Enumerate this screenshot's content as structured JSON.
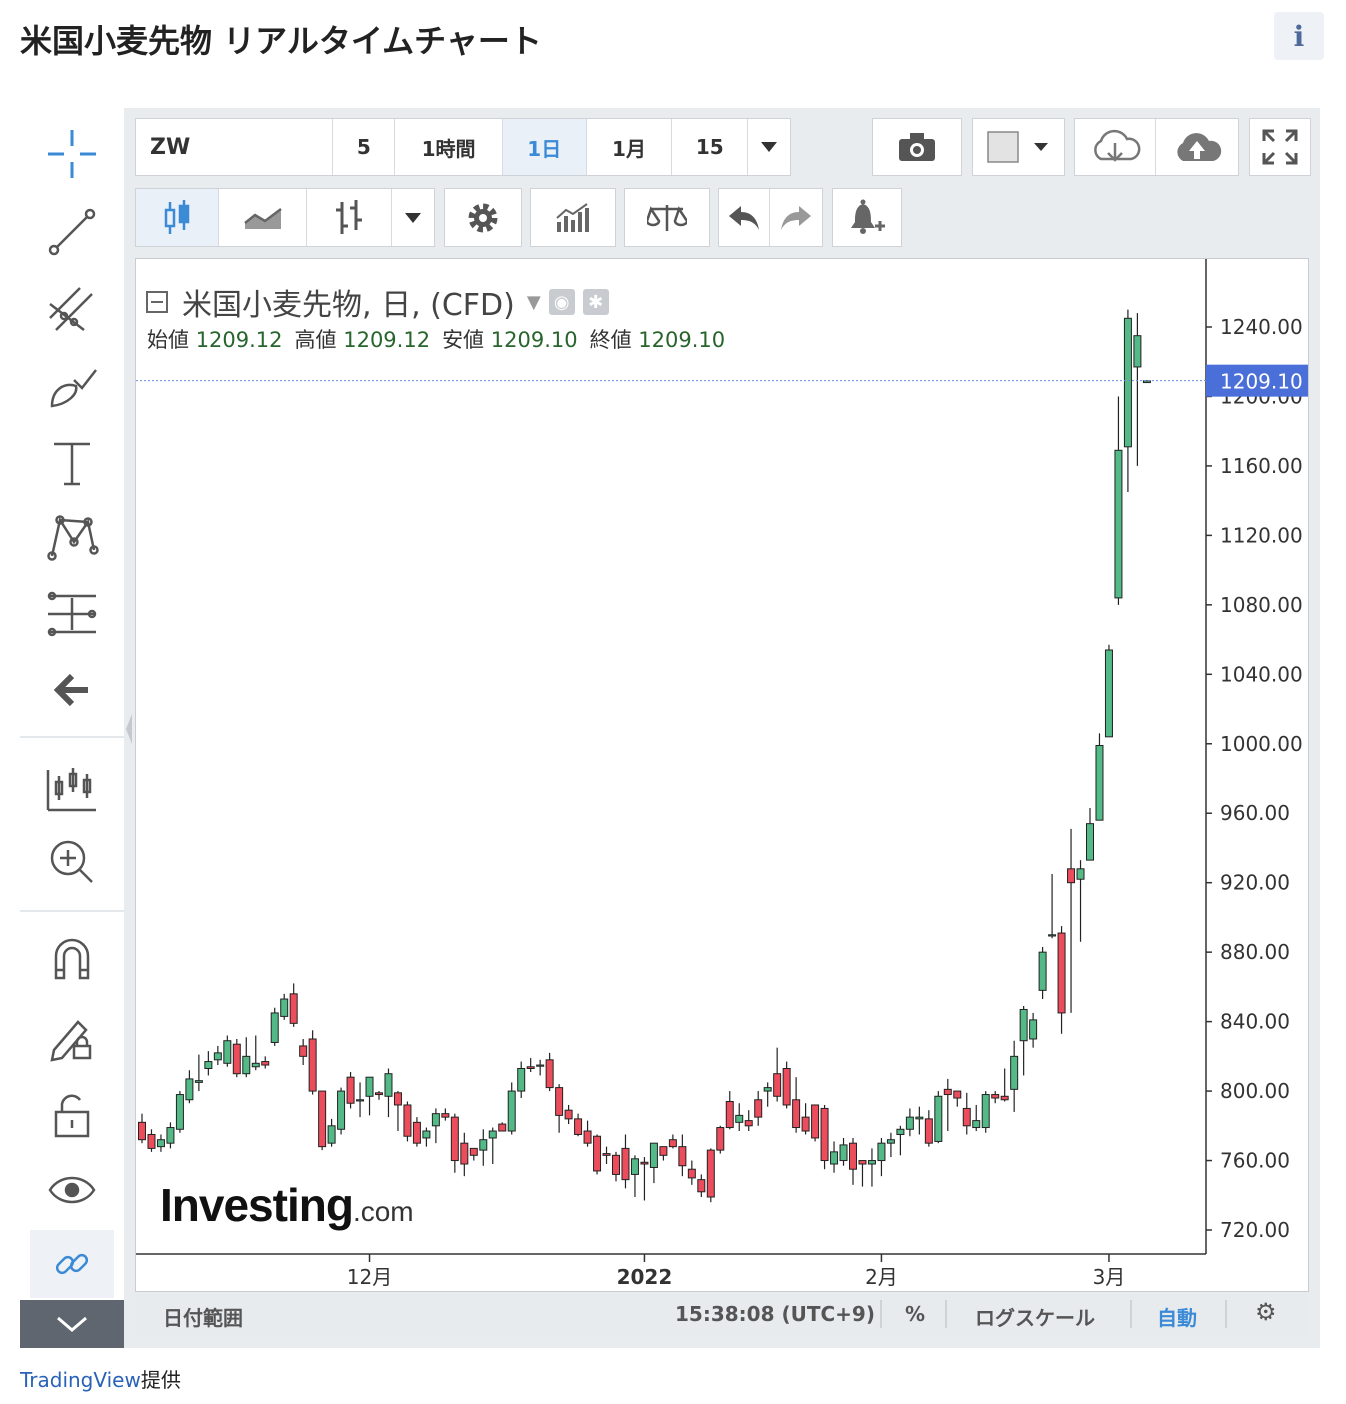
{
  "page": {
    "title": "米国小麦先物 リアルタイムチャート",
    "info_icon": "i"
  },
  "toolbar": {
    "symbol": "ZW",
    "intervals": [
      "5",
      "1時間",
      "1日",
      "1月",
      "15"
    ],
    "active_interval": "1日",
    "icons": [
      "camera-icon",
      "color-swatch-icon",
      "cloud-download-icon",
      "cloud-upload-icon",
      "fullscreen-icon"
    ]
  },
  "toolbar2": {
    "icons": [
      "candles-icon",
      "area-chart-icon",
      "bars-icon",
      "dropdown-icon",
      "settings-icon",
      "indicators-icon",
      "compare-icon",
      "undo-icon",
      "redo-icon",
      "alert-icon"
    ]
  },
  "sidebar": {
    "tools": [
      "crosshair-icon",
      "trendline-icon",
      "fib-icon",
      "brush-icon",
      "text-icon",
      "pattern-icon",
      "measure-icon",
      "back-arrow-icon",
      "candle-settings-icon",
      "zoom-icon",
      "magnet-icon",
      "lock-drawing-icon",
      "unlock-icon",
      "eye-icon",
      "link-icon"
    ]
  },
  "legend": {
    "title": "米国小麦先物, 日, (CFD)",
    "open_label": "始値",
    "open": "1209.12",
    "high_label": "高値",
    "high": "1209.12",
    "low_label": "安値",
    "low": "1209.10",
    "close_label": "終値",
    "close": "1209.10"
  },
  "price_axis": {
    "ticks": [
      "1240.00",
      "1200.00",
      "1160.00",
      "1120.00",
      "1080.00",
      "1040.00",
      "1000.00",
      "960.00",
      "920.00",
      "880.00",
      "840.00",
      "800.00",
      "760.00",
      "720.00"
    ],
    "current_price": "1209.10"
  },
  "time_axis": {
    "labels": [
      "12月",
      "2022",
      "2月",
      "3月"
    ]
  },
  "status_bar": {
    "date_range": "日付範囲",
    "time": "15:38:08 (UTC+9)",
    "percent": "%",
    "log_scale": "ログスケール",
    "auto": "自動"
  },
  "watermark": {
    "main": "Investing",
    "suffix": ".com"
  },
  "footer": {
    "brand": "TradingView",
    "suffix": "提供"
  },
  "colors": {
    "up": "#53b987",
    "down": "#eb4d5c",
    "accent": "#3a8ad6",
    "price_label": "#4a6fd8"
  },
  "chart_data": {
    "type": "candlestick",
    "title": "米国小麦先物, 日, (CFD)",
    "ylim": [
      700,
      1260
    ],
    "current": 1209.1,
    "candles": [
      [
        782,
        772,
        787,
        770
      ],
      [
        775,
        767,
        778,
        765
      ],
      [
        768,
        772,
        775,
        765
      ],
      [
        770,
        779,
        782,
        767
      ],
      [
        778,
        798,
        800,
        776
      ],
      [
        795,
        807,
        812,
        793
      ],
      [
        805,
        806,
        821,
        800
      ],
      [
        813,
        817,
        823,
        809
      ],
      [
        818,
        822,
        826,
        815
      ],
      [
        816,
        829,
        832,
        814
      ],
      [
        827,
        810,
        830,
        808
      ],
      [
        810,
        820,
        831,
        808
      ],
      [
        814,
        816,
        832,
        812
      ],
      [
        817,
        815,
        820,
        813
      ],
      [
        828,
        845,
        848,
        826
      ],
      [
        843,
        853,
        856,
        841
      ],
      [
        856,
        839,
        862,
        837
      ],
      [
        826,
        820,
        830,
        815
      ],
      [
        830,
        800,
        835,
        798
      ],
      [
        800,
        768,
        800,
        766
      ],
      [
        770,
        780,
        784,
        768
      ],
      [
        778,
        800,
        802,
        775
      ],
      [
        808,
        793,
        811,
        790
      ],
      [
        795,
        795,
        805,
        785
      ],
      [
        797,
        808,
        808,
        786
      ],
      [
        799,
        798,
        800,
        795
      ],
      [
        797,
        810,
        813,
        785
      ],
      [
        799,
        792,
        800,
        777
      ],
      [
        792,
        774,
        794,
        771
      ],
      [
        782,
        770,
        785,
        768
      ],
      [
        773,
        777,
        779,
        768
      ],
      [
        780,
        787,
        790,
        770
      ],
      [
        787,
        785,
        790,
        783
      ],
      [
        785,
        760,
        787,
        753
      ],
      [
        770,
        758,
        776,
        751
      ],
      [
        767,
        763,
        767,
        760
      ],
      [
        766,
        772,
        778,
        757
      ],
      [
        773,
        777,
        779,
        758
      ],
      [
        781,
        777,
        782,
        777
      ],
      [
        777,
        800,
        805,
        775
      ],
      [
        800,
        813,
        817,
        796
      ],
      [
        814,
        813,
        819,
        811
      ],
      [
        815,
        815,
        818,
        809
      ],
      [
        818,
        802,
        822,
        800
      ],
      [
        802,
        786,
        804,
        776
      ],
      [
        789,
        784,
        792,
        781
      ],
      [
        784,
        775,
        787,
        774
      ],
      [
        777,
        770,
        783,
        768
      ],
      [
        774,
        754,
        775,
        752
      ],
      [
        764,
        763,
        768,
        758
      ],
      [
        763,
        752,
        765,
        748
      ],
      [
        767,
        749,
        775,
        744
      ],
      [
        752,
        761,
        763,
        739
      ],
      [
        759,
        758,
        762,
        737
      ],
      [
        756,
        770,
        770,
        747
      ],
      [
        768,
        763,
        768,
        760
      ],
      [
        772,
        768,
        775,
        767
      ],
      [
        768,
        757,
        775,
        751
      ],
      [
        755,
        750,
        760,
        746
      ],
      [
        749,
        742,
        752,
        739
      ],
      [
        766,
        739,
        767,
        736
      ],
      [
        779,
        766,
        780,
        764
      ],
      [
        794,
        779,
        800,
        778
      ],
      [
        782,
        786,
        793,
        777
      ],
      [
        783,
        780,
        789,
        777
      ],
      [
        795,
        785,
        800,
        780
      ],
      [
        800,
        802,
        805,
        791
      ],
      [
        810,
        797,
        825,
        794
      ],
      [
        813,
        792,
        817,
        790
      ],
      [
        795,
        779,
        808,
        776
      ],
      [
        785,
        777,
        793,
        775
      ],
      [
        792,
        773,
        792,
        771
      ],
      [
        790,
        760,
        792,
        755
      ],
      [
        758,
        765,
        771,
        753
      ],
      [
        760,
        769,
        773,
        757
      ],
      [
        770,
        755,
        773,
        746
      ],
      [
        760,
        758,
        760,
        745
      ],
      [
        758,
        760,
        767,
        745
      ],
      [
        760,
        770,
        773,
        751
      ],
      [
        770,
        772,
        776,
        762
      ],
      [
        775,
        778,
        780,
        763
      ],
      [
        778,
        785,
        790,
        774
      ],
      [
        784,
        785,
        791,
        775
      ],
      [
        784,
        770,
        789,
        768
      ],
      [
        771,
        797,
        800,
        770
      ],
      [
        801,
        798,
        807,
        777
      ],
      [
        800,
        796,
        800,
        791
      ],
      [
        790,
        780,
        799,
        775
      ],
      [
        779,
        783,
        792,
        777
      ],
      [
        779,
        798,
        800,
        776
      ],
      [
        798,
        796,
        800,
        793
      ],
      [
        797,
        795,
        813,
        794
      ],
      [
        801,
        820,
        829,
        788
      ],
      [
        829,
        847,
        849,
        809
      ],
      [
        830,
        841,
        845,
        825
      ],
      [
        858,
        880,
        883,
        853
      ],
      [
        890,
        890,
        925,
        888
      ],
      [
        891,
        845,
        895,
        833
      ],
      [
        928,
        920,
        951,
        845
      ],
      [
        922,
        928,
        933,
        886
      ],
      [
        933,
        954,
        963,
        952
      ],
      [
        956,
        999,
        1006,
        960
      ],
      [
        1004,
        1054,
        1057,
        1006
      ],
      [
        1084,
        1169,
        1200,
        1080
      ],
      [
        1171,
        1245,
        1250,
        1145
      ],
      [
        1217,
        1235,
        1248,
        1160
      ],
      [
        1208,
        1209,
        1209,
        1208
      ]
    ]
  }
}
